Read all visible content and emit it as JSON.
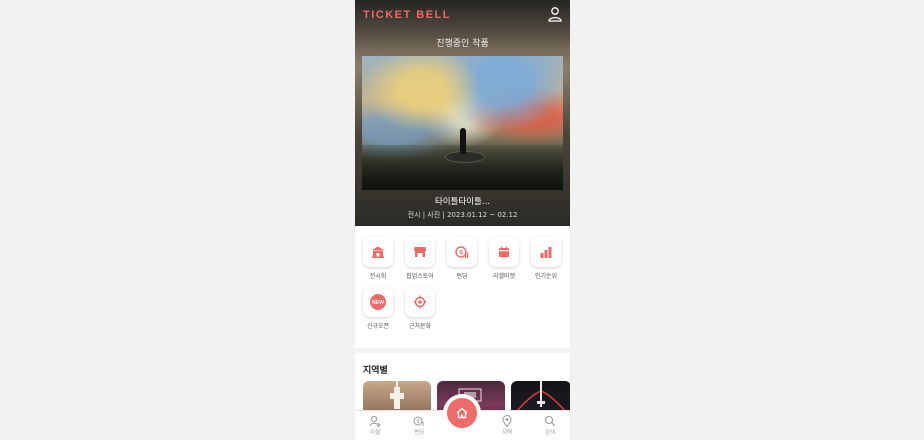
{
  "app": {
    "logo_text": "TICKET BELL",
    "brand_color": "#ee6a66"
  },
  "hero": {
    "section_label": "진행중인 작품",
    "slide_title": "타이틀타이틀...",
    "slide_meta": "전시 | 사진 | 2023.01.12 ~ 02.12"
  },
  "menu": {
    "items": [
      {
        "label": "전시회",
        "icon": "museum-icon"
      },
      {
        "label": "팝업스토어",
        "icon": "store-icon"
      },
      {
        "label": "펀딩",
        "icon": "funding-coin-icon"
      },
      {
        "label": "리셀마켓",
        "icon": "market-icon"
      },
      {
        "label": "인기순위",
        "icon": "bar-chart-icon"
      },
      {
        "label": "신규오픈",
        "icon": "new-badge-icon"
      },
      {
        "label": "근처문화",
        "icon": "location-target-icon"
      }
    ],
    "new_badge_text": "NEW"
  },
  "region": {
    "title": "지역별"
  },
  "tabbar": {
    "items": [
      {
        "label": "리셀",
        "icon": "resell-icon"
      },
      {
        "label": "펀딩",
        "icon": "funding-icon"
      },
      {
        "label": "홈",
        "icon": "home-icon"
      },
      {
        "label": "지역",
        "icon": "map-pin-icon"
      },
      {
        "label": "검색",
        "icon": "search-icon"
      }
    ]
  }
}
